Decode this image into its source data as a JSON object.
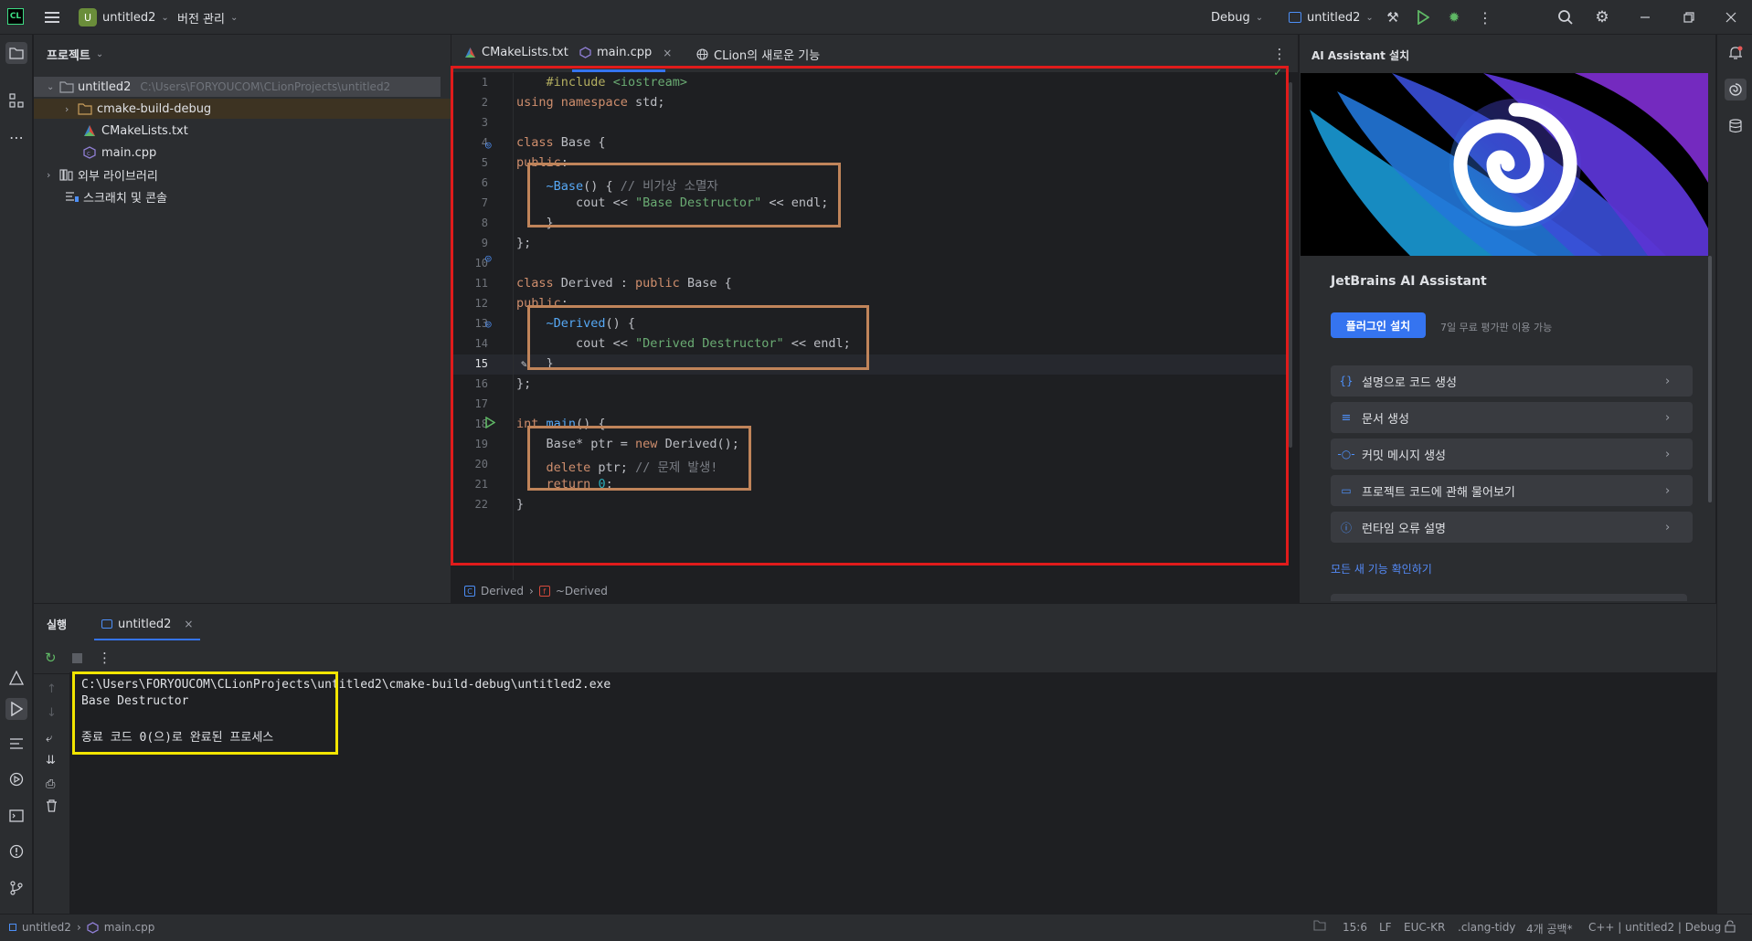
{
  "topbar": {
    "project_badge": "U",
    "project_name": "untitled2",
    "vcs_label": "버전 관리",
    "config_label": "Debug",
    "run_target": "untitled2"
  },
  "project_panel": {
    "title": "프로젝트",
    "root_name": "untitled2",
    "root_path": "C:\\Users\\FORYOUCOM\\CLionProjects\\untitled2",
    "items": [
      "cmake-build-debug",
      "CMakeLists.txt",
      "main.cpp",
      "외부 라이브러리",
      "스크래치 및 콘솔"
    ]
  },
  "editor": {
    "tabs": [
      "CMakeLists.txt",
      "main.cpp",
      "CLion의 새로운 기능"
    ],
    "line_numbers": [
      "1",
      "2",
      "3",
      "4",
      "5",
      "6",
      "7",
      "8",
      "9",
      "10",
      "11",
      "12",
      "13",
      "14",
      "15",
      "16",
      "17",
      "18",
      "19",
      "20",
      "21",
      "22"
    ],
    "breadcrumb": [
      "Derived",
      "~Derived"
    ],
    "colors": {
      "highlight_red": "#e01b1b",
      "highlight_brown": "#c0845a",
      "highlight_yellow": "#f2e500"
    }
  },
  "ai_panel": {
    "header": "AI Assistant 설치",
    "title": "JetBrains AI Assistant",
    "install_button": "플러그인 설치",
    "trial_text": "7일 무료 평가판 이용 가능",
    "items": [
      "설명으로 코드 생성",
      "문서 생성",
      "커밋 메시지 생성",
      "프로젝트 코드에 관해 물어보기",
      "런타임 오류 설명"
    ],
    "link": "모든 새 기능 확인하기"
  },
  "run_panel": {
    "tab_label": "실행",
    "run_tab": "untitled2",
    "console_lines": [
      "C:\\Users\\FORYOUCOM\\CLionProjects\\untitled2\\cmake-build-debug\\untitled2.exe",
      "Base Destructor",
      "",
      "종료 코드 0(으)로 완료된 프로세스"
    ]
  },
  "status_bar": {
    "project": "untitled2",
    "file": "main.cpp",
    "position": "15:6",
    "line_sep": "LF",
    "encoding": "EUC-KR",
    "linter": ".clang-tidy",
    "indent": "4개 공백*",
    "context": "C++ | untitled2 | Debug"
  }
}
